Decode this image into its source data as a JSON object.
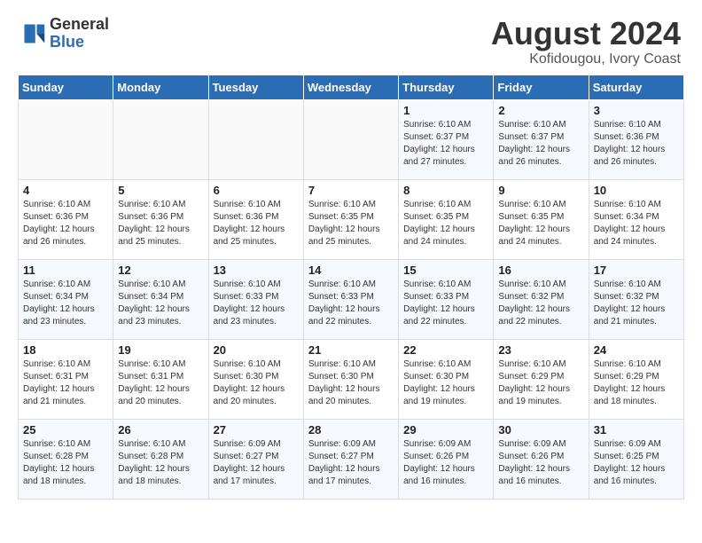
{
  "header": {
    "logo_general": "General",
    "logo_blue": "Blue",
    "main_title": "August 2024",
    "subtitle": "Kofidougou, Ivory Coast"
  },
  "days_of_week": [
    "Sunday",
    "Monday",
    "Tuesday",
    "Wednesday",
    "Thursday",
    "Friday",
    "Saturday"
  ],
  "weeks": [
    [
      {
        "day": "",
        "info": ""
      },
      {
        "day": "",
        "info": ""
      },
      {
        "day": "",
        "info": ""
      },
      {
        "day": "",
        "info": ""
      },
      {
        "day": "1",
        "info": "Sunrise: 6:10 AM\nSunset: 6:37 PM\nDaylight: 12 hours\nand 27 minutes."
      },
      {
        "day": "2",
        "info": "Sunrise: 6:10 AM\nSunset: 6:37 PM\nDaylight: 12 hours\nand 26 minutes."
      },
      {
        "day": "3",
        "info": "Sunrise: 6:10 AM\nSunset: 6:36 PM\nDaylight: 12 hours\nand 26 minutes."
      }
    ],
    [
      {
        "day": "4",
        "info": "Sunrise: 6:10 AM\nSunset: 6:36 PM\nDaylight: 12 hours\nand 26 minutes."
      },
      {
        "day": "5",
        "info": "Sunrise: 6:10 AM\nSunset: 6:36 PM\nDaylight: 12 hours\nand 25 minutes."
      },
      {
        "day": "6",
        "info": "Sunrise: 6:10 AM\nSunset: 6:36 PM\nDaylight: 12 hours\nand 25 minutes."
      },
      {
        "day": "7",
        "info": "Sunrise: 6:10 AM\nSunset: 6:35 PM\nDaylight: 12 hours\nand 25 minutes."
      },
      {
        "day": "8",
        "info": "Sunrise: 6:10 AM\nSunset: 6:35 PM\nDaylight: 12 hours\nand 24 minutes."
      },
      {
        "day": "9",
        "info": "Sunrise: 6:10 AM\nSunset: 6:35 PM\nDaylight: 12 hours\nand 24 minutes."
      },
      {
        "day": "10",
        "info": "Sunrise: 6:10 AM\nSunset: 6:34 PM\nDaylight: 12 hours\nand 24 minutes."
      }
    ],
    [
      {
        "day": "11",
        "info": "Sunrise: 6:10 AM\nSunset: 6:34 PM\nDaylight: 12 hours\nand 23 minutes."
      },
      {
        "day": "12",
        "info": "Sunrise: 6:10 AM\nSunset: 6:34 PM\nDaylight: 12 hours\nand 23 minutes."
      },
      {
        "day": "13",
        "info": "Sunrise: 6:10 AM\nSunset: 6:33 PM\nDaylight: 12 hours\nand 23 minutes."
      },
      {
        "day": "14",
        "info": "Sunrise: 6:10 AM\nSunset: 6:33 PM\nDaylight: 12 hours\nand 22 minutes."
      },
      {
        "day": "15",
        "info": "Sunrise: 6:10 AM\nSunset: 6:33 PM\nDaylight: 12 hours\nand 22 minutes."
      },
      {
        "day": "16",
        "info": "Sunrise: 6:10 AM\nSunset: 6:32 PM\nDaylight: 12 hours\nand 22 minutes."
      },
      {
        "day": "17",
        "info": "Sunrise: 6:10 AM\nSunset: 6:32 PM\nDaylight: 12 hours\nand 21 minutes."
      }
    ],
    [
      {
        "day": "18",
        "info": "Sunrise: 6:10 AM\nSunset: 6:31 PM\nDaylight: 12 hours\nand 21 minutes."
      },
      {
        "day": "19",
        "info": "Sunrise: 6:10 AM\nSunset: 6:31 PM\nDaylight: 12 hours\nand 20 minutes."
      },
      {
        "day": "20",
        "info": "Sunrise: 6:10 AM\nSunset: 6:30 PM\nDaylight: 12 hours\nand 20 minutes."
      },
      {
        "day": "21",
        "info": "Sunrise: 6:10 AM\nSunset: 6:30 PM\nDaylight: 12 hours\nand 20 minutes."
      },
      {
        "day": "22",
        "info": "Sunrise: 6:10 AM\nSunset: 6:30 PM\nDaylight: 12 hours\nand 19 minutes."
      },
      {
        "day": "23",
        "info": "Sunrise: 6:10 AM\nSunset: 6:29 PM\nDaylight: 12 hours\nand 19 minutes."
      },
      {
        "day": "24",
        "info": "Sunrise: 6:10 AM\nSunset: 6:29 PM\nDaylight: 12 hours\nand 18 minutes."
      }
    ],
    [
      {
        "day": "25",
        "info": "Sunrise: 6:10 AM\nSunset: 6:28 PM\nDaylight: 12 hours\nand 18 minutes."
      },
      {
        "day": "26",
        "info": "Sunrise: 6:10 AM\nSunset: 6:28 PM\nDaylight: 12 hours\nand 18 minutes."
      },
      {
        "day": "27",
        "info": "Sunrise: 6:09 AM\nSunset: 6:27 PM\nDaylight: 12 hours\nand 17 minutes."
      },
      {
        "day": "28",
        "info": "Sunrise: 6:09 AM\nSunset: 6:27 PM\nDaylight: 12 hours\nand 17 minutes."
      },
      {
        "day": "29",
        "info": "Sunrise: 6:09 AM\nSunset: 6:26 PM\nDaylight: 12 hours\nand 16 minutes."
      },
      {
        "day": "30",
        "info": "Sunrise: 6:09 AM\nSunset: 6:26 PM\nDaylight: 12 hours\nand 16 minutes."
      },
      {
        "day": "31",
        "info": "Sunrise: 6:09 AM\nSunset: 6:25 PM\nDaylight: 12 hours\nand 16 minutes."
      }
    ]
  ]
}
